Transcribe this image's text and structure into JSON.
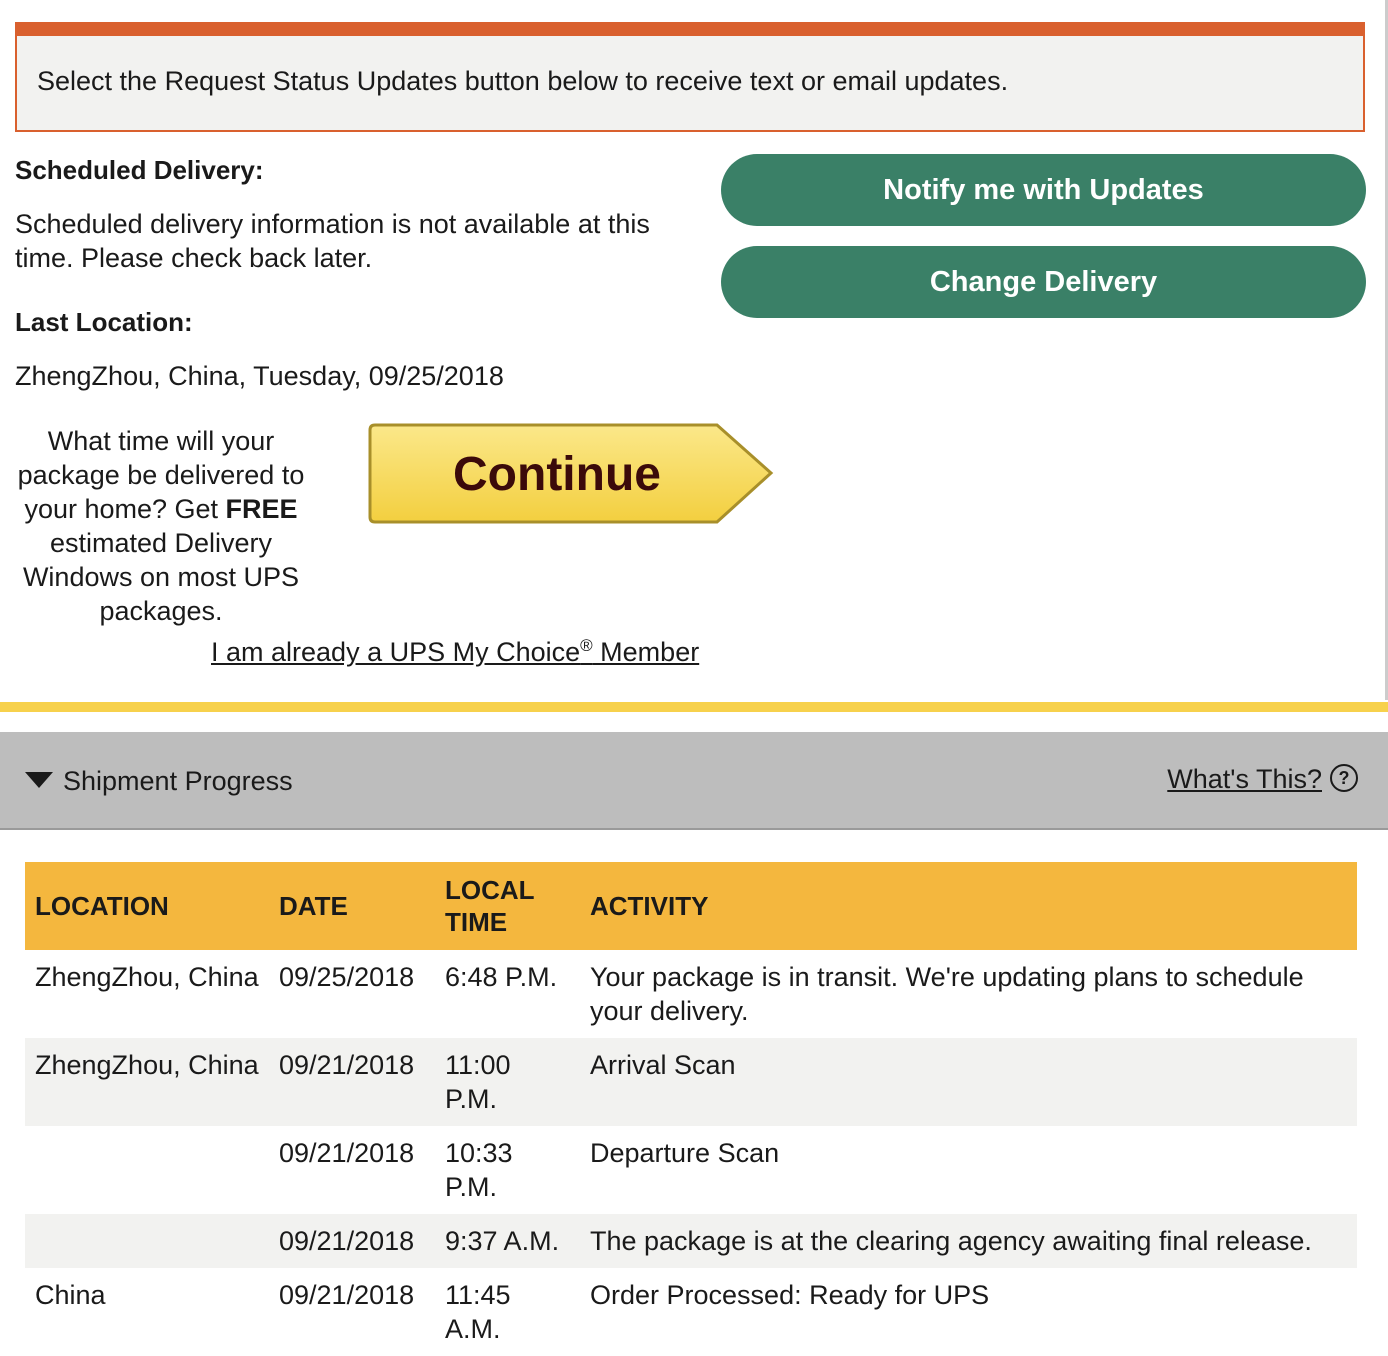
{
  "alert": {
    "text": "Select the Request Status Updates button below to receive text or email updates."
  },
  "scheduled": {
    "label": "Scheduled Delivery:",
    "text": "Scheduled delivery information is not available at this time. Please check back later."
  },
  "last_location": {
    "label": "Last Location:",
    "value": "ZhengZhou, China, Tuesday, 09/25/2018"
  },
  "buttons": {
    "notify": "Notify me with Updates",
    "change": "Change Delivery",
    "continue": "Continue"
  },
  "promo": {
    "part1": "What time will your package be delivered to your home? Get ",
    "bold": "FREE",
    "part2": " estimated Delivery Windows on most UPS packages."
  },
  "member_link": {
    "prefix": "I am already a UPS My Choice",
    "sup": "®",
    "suffix": " Member"
  },
  "progress": {
    "title": "Shipment Progress",
    "whats_this": "What's This?",
    "help_glyph": "?"
  },
  "table": {
    "headers": [
      "LOCATION",
      "DATE",
      "LOCAL TIME",
      "ACTIVITY"
    ],
    "rows": [
      [
        "ZhengZhou,  China",
        "09/25/2018",
        "6:48 P.M.",
        "Your package is in transit. We're updating plans to schedule your delivery."
      ],
      [
        "ZhengZhou,  China",
        "09/21/2018",
        "11:00 P.M.",
        "Arrival Scan"
      ],
      [
        "",
        "09/21/2018",
        "10:33 P.M.",
        "Departure Scan"
      ],
      [
        "",
        "09/21/2018",
        "9:37 A.M.",
        "The package is at the clearing agency awaiting final release."
      ],
      [
        "China",
        "09/21/2018",
        "11:45 A.M.",
        "Order Processed: Ready for UPS"
      ]
    ]
  },
  "colors": {
    "alert_border": "#d9602e",
    "green_button": "#3a8067",
    "table_header": "#f4b73e",
    "continue_fill": "#f8dc5c",
    "divider_yellow": "#f7d14c"
  }
}
